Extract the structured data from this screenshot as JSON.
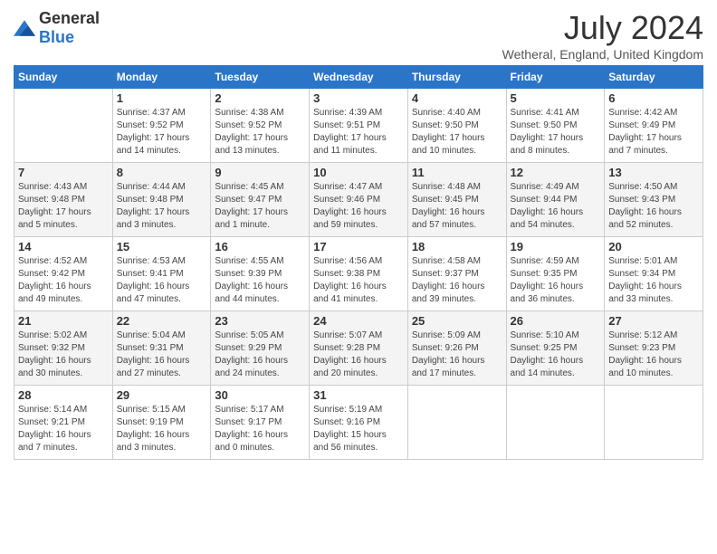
{
  "header": {
    "logo_general": "General",
    "logo_blue": "Blue",
    "title": "July 2024",
    "location": "Wetheral, England, United Kingdom"
  },
  "days_of_week": [
    "Sunday",
    "Monday",
    "Tuesday",
    "Wednesday",
    "Thursday",
    "Friday",
    "Saturday"
  ],
  "weeks": [
    [
      {
        "day": "",
        "info": ""
      },
      {
        "day": "1",
        "info": "Sunrise: 4:37 AM\nSunset: 9:52 PM\nDaylight: 17 hours\nand 14 minutes."
      },
      {
        "day": "2",
        "info": "Sunrise: 4:38 AM\nSunset: 9:52 PM\nDaylight: 17 hours\nand 13 minutes."
      },
      {
        "day": "3",
        "info": "Sunrise: 4:39 AM\nSunset: 9:51 PM\nDaylight: 17 hours\nand 11 minutes."
      },
      {
        "day": "4",
        "info": "Sunrise: 4:40 AM\nSunset: 9:50 PM\nDaylight: 17 hours\nand 10 minutes."
      },
      {
        "day": "5",
        "info": "Sunrise: 4:41 AM\nSunset: 9:50 PM\nDaylight: 17 hours\nand 8 minutes."
      },
      {
        "day": "6",
        "info": "Sunrise: 4:42 AM\nSunset: 9:49 PM\nDaylight: 17 hours\nand 7 minutes."
      }
    ],
    [
      {
        "day": "7",
        "info": "Sunrise: 4:43 AM\nSunset: 9:48 PM\nDaylight: 17 hours\nand 5 minutes."
      },
      {
        "day": "8",
        "info": "Sunrise: 4:44 AM\nSunset: 9:48 PM\nDaylight: 17 hours\nand 3 minutes."
      },
      {
        "day": "9",
        "info": "Sunrise: 4:45 AM\nSunset: 9:47 PM\nDaylight: 17 hours\nand 1 minute."
      },
      {
        "day": "10",
        "info": "Sunrise: 4:47 AM\nSunset: 9:46 PM\nDaylight: 16 hours\nand 59 minutes."
      },
      {
        "day": "11",
        "info": "Sunrise: 4:48 AM\nSunset: 9:45 PM\nDaylight: 16 hours\nand 57 minutes."
      },
      {
        "day": "12",
        "info": "Sunrise: 4:49 AM\nSunset: 9:44 PM\nDaylight: 16 hours\nand 54 minutes."
      },
      {
        "day": "13",
        "info": "Sunrise: 4:50 AM\nSunset: 9:43 PM\nDaylight: 16 hours\nand 52 minutes."
      }
    ],
    [
      {
        "day": "14",
        "info": "Sunrise: 4:52 AM\nSunset: 9:42 PM\nDaylight: 16 hours\nand 49 minutes."
      },
      {
        "day": "15",
        "info": "Sunrise: 4:53 AM\nSunset: 9:41 PM\nDaylight: 16 hours\nand 47 minutes."
      },
      {
        "day": "16",
        "info": "Sunrise: 4:55 AM\nSunset: 9:39 PM\nDaylight: 16 hours\nand 44 minutes."
      },
      {
        "day": "17",
        "info": "Sunrise: 4:56 AM\nSunset: 9:38 PM\nDaylight: 16 hours\nand 41 minutes."
      },
      {
        "day": "18",
        "info": "Sunrise: 4:58 AM\nSunset: 9:37 PM\nDaylight: 16 hours\nand 39 minutes."
      },
      {
        "day": "19",
        "info": "Sunrise: 4:59 AM\nSunset: 9:35 PM\nDaylight: 16 hours\nand 36 minutes."
      },
      {
        "day": "20",
        "info": "Sunrise: 5:01 AM\nSunset: 9:34 PM\nDaylight: 16 hours\nand 33 minutes."
      }
    ],
    [
      {
        "day": "21",
        "info": "Sunrise: 5:02 AM\nSunset: 9:32 PM\nDaylight: 16 hours\nand 30 minutes."
      },
      {
        "day": "22",
        "info": "Sunrise: 5:04 AM\nSunset: 9:31 PM\nDaylight: 16 hours\nand 27 minutes."
      },
      {
        "day": "23",
        "info": "Sunrise: 5:05 AM\nSunset: 9:29 PM\nDaylight: 16 hours\nand 24 minutes."
      },
      {
        "day": "24",
        "info": "Sunrise: 5:07 AM\nSunset: 9:28 PM\nDaylight: 16 hours\nand 20 minutes."
      },
      {
        "day": "25",
        "info": "Sunrise: 5:09 AM\nSunset: 9:26 PM\nDaylight: 16 hours\nand 17 minutes."
      },
      {
        "day": "26",
        "info": "Sunrise: 5:10 AM\nSunset: 9:25 PM\nDaylight: 16 hours\nand 14 minutes."
      },
      {
        "day": "27",
        "info": "Sunrise: 5:12 AM\nSunset: 9:23 PM\nDaylight: 16 hours\nand 10 minutes."
      }
    ],
    [
      {
        "day": "28",
        "info": "Sunrise: 5:14 AM\nSunset: 9:21 PM\nDaylight: 16 hours\nand 7 minutes."
      },
      {
        "day": "29",
        "info": "Sunrise: 5:15 AM\nSunset: 9:19 PM\nDaylight: 16 hours\nand 3 minutes."
      },
      {
        "day": "30",
        "info": "Sunrise: 5:17 AM\nSunset: 9:17 PM\nDaylight: 16 hours\nand 0 minutes."
      },
      {
        "day": "31",
        "info": "Sunrise: 5:19 AM\nSunset: 9:16 PM\nDaylight: 15 hours\nand 56 minutes."
      },
      {
        "day": "",
        "info": ""
      },
      {
        "day": "",
        "info": ""
      },
      {
        "day": "",
        "info": ""
      }
    ]
  ]
}
